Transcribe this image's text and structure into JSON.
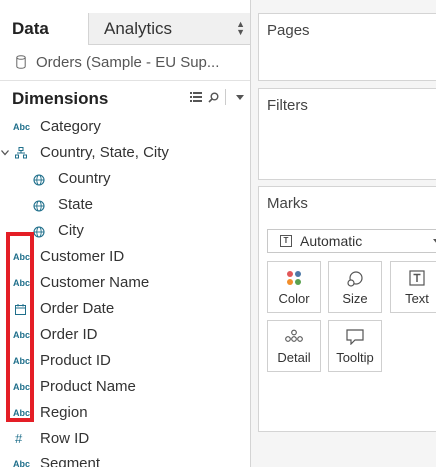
{
  "tabs": {
    "data": "Data",
    "analytics": "Analytics"
  },
  "datasource": {
    "name": "Orders (Sample - EU Sup..."
  },
  "dimensions": {
    "title": "Dimensions",
    "fields": [
      {
        "type": "Abc",
        "name": "Category"
      },
      {
        "type": "hierarchy",
        "name": "Country, State, City"
      },
      {
        "type": "geo",
        "name": "Country"
      },
      {
        "type": "geo",
        "name": "State"
      },
      {
        "type": "geo",
        "name": "City"
      },
      {
        "type": "Abc",
        "name": "Customer ID"
      },
      {
        "type": "Abc",
        "name": "Customer Name"
      },
      {
        "type": "date",
        "name": "Order Date"
      },
      {
        "type": "Abc",
        "name": "Order ID"
      },
      {
        "type": "Abc",
        "name": "Product ID"
      },
      {
        "type": "Abc",
        "name": "Product Name"
      },
      {
        "type": "Abc",
        "name": "Region"
      },
      {
        "type": "number",
        "name": "Row ID"
      },
      {
        "type": "Abc",
        "name": "Segment"
      }
    ]
  },
  "shelves": {
    "pages": "Pages",
    "filters": "Filters",
    "marks": "Marks"
  },
  "marks": {
    "type": "Automatic",
    "buttons": {
      "color": "Color",
      "size": "Size",
      "text": "Text",
      "detail": "Detail",
      "tooltip": "Tooltip"
    }
  },
  "colors": {
    "accent": "#1f6f8b",
    "highlight": "#e41e26"
  }
}
